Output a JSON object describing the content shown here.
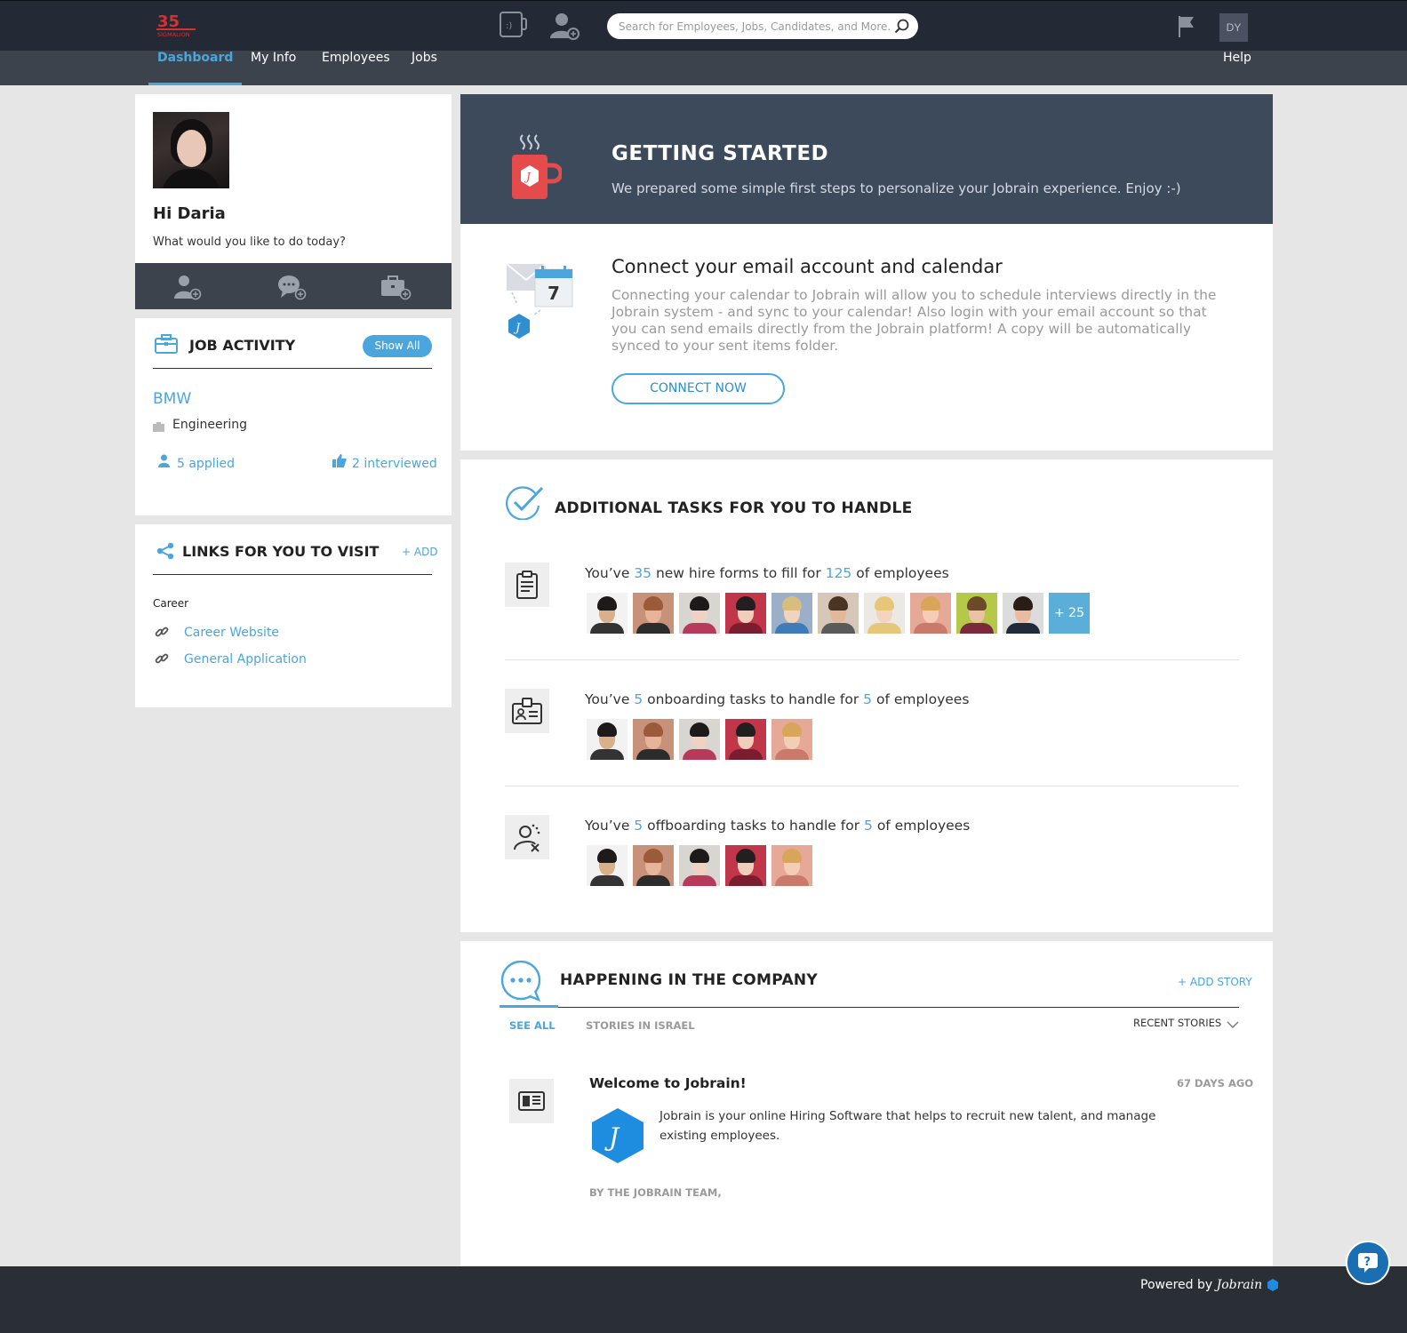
{
  "header": {
    "logo_text": "SIGMALION",
    "search": {
      "placeholder": "Search for Employees, Jobs, Candidates, and More..."
    },
    "user_initials": "DY"
  },
  "nav": {
    "items": [
      {
        "label": "Dashboard",
        "active": true
      },
      {
        "label": "My Info"
      },
      {
        "label": "Employees"
      },
      {
        "label": "Jobs"
      }
    ],
    "help": "Help"
  },
  "profile": {
    "greeting": "Hi Daria",
    "subtitle": "What would you like to do today?",
    "quick_actions": [
      "add-employee-icon",
      "add-message-icon",
      "add-job-icon"
    ]
  },
  "job_activity": {
    "title": "JOB ACTIVITY",
    "show_all": "Show All",
    "company": "BMW",
    "department": "Engineering",
    "applied": "5 applied",
    "interviewed": "2 interviewed"
  },
  "links": {
    "title": "LINKS FOR YOU TO VISIT",
    "add": "+ ADD",
    "group": "Career",
    "items": [
      "Career Website",
      "General Application"
    ]
  },
  "getting_started": {
    "title": "GETTING STARTED",
    "subtitle": "We prepared some simple first steps to personalize your Jobrain experience. Enjoy :-)"
  },
  "connect": {
    "title": "Connect your email account and calendar",
    "description": "Connecting your calendar to Jobrain will allow you to schedule interviews directly in the Jobrain system - and sync to your calendar! Also login with your email account so that you can send emails directly from the Jobrain platform! A copy will be automatically synced to your sent items folder.",
    "button": "CONNECT NOW",
    "calendar_day": "7"
  },
  "tasks": {
    "title": "ADDITIONAL TASKS FOR YOU TO HANDLE",
    "items": [
      {
        "prefix": "You’ve ",
        "count": "35",
        "middle": " new hire forms to fill for ",
        "people": "125",
        "suffix": " of employees",
        "more": "+ 25"
      },
      {
        "prefix": "You’ve ",
        "count": "5",
        "middle": " onboarding tasks to handle for ",
        "people": "5",
        "suffix": " of employees"
      },
      {
        "prefix": "You’ve ",
        "count": "5",
        "middle": " offboarding tasks to handle for ",
        "people": "5",
        "suffix": " of employees"
      }
    ]
  },
  "happening": {
    "title": "HAPPENING IN THE COMPANY",
    "add_story": "+ ADD STORY",
    "tabs": [
      "SEE ALL",
      "STORIES IN ISRAEL"
    ],
    "sort": "RECENT STORIES",
    "story": {
      "title": "Welcome to Jobrain!",
      "age": "67 DAYS AGO",
      "body": "Jobrain is your online Hiring Software that helps to recruit new talent, and manage existing employees.",
      "byline": "BY THE JOBRAIN TEAM,"
    }
  },
  "footer": {
    "powered_by": "Powered by",
    "brand": "Jobrain"
  },
  "colors": {
    "accent": "#4aa6dc",
    "topbar": "#232a35",
    "navbar": "#3d434c",
    "hero": "#3d4a5c"
  }
}
